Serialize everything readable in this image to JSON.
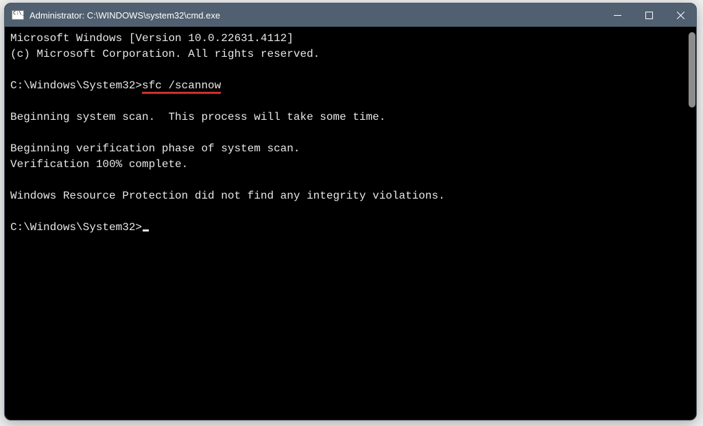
{
  "titlebar": {
    "title": "Administrator: C:\\WINDOWS\\system32\\cmd.exe"
  },
  "terminal": {
    "line1": "Microsoft Windows [Version 10.0.22631.4112]",
    "line2": "(c) Microsoft Corporation. All rights reserved.",
    "blank1": "",
    "prompt1_path": "C:\\Windows\\System32>",
    "prompt1_cmd": "sfc /scannow",
    "blank2": "",
    "line3": "Beginning system scan.  This process will take some time.",
    "blank3": "",
    "line4": "Beginning verification phase of system scan.",
    "line5": "Verification 100% complete.",
    "blank4": "",
    "line6": "Windows Resource Protection did not find any integrity violations.",
    "blank5": "",
    "prompt2_path": "C:\\Windows\\System32>"
  }
}
